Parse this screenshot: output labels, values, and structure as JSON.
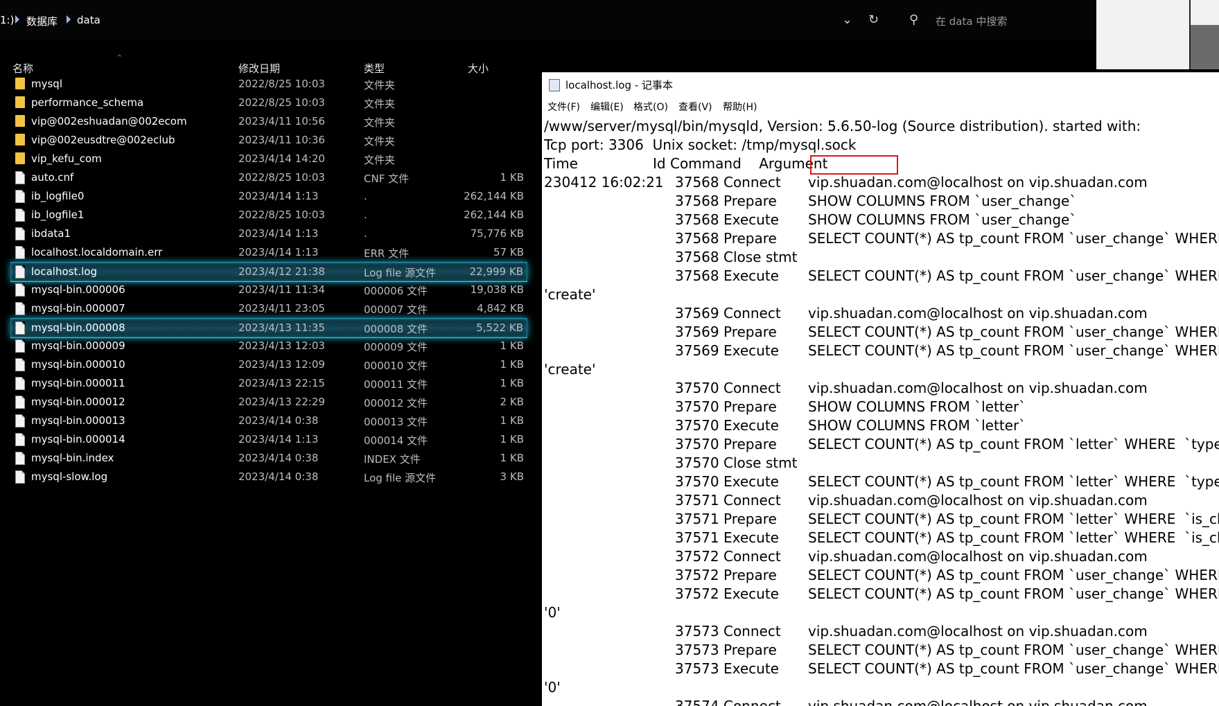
{
  "breadcrumb": {
    "drive": "1:)",
    "folder1": "数据库",
    "folder2": "data"
  },
  "toolbar": {
    "search_placeholder": "在 data 中搜索"
  },
  "columns": {
    "name": "名称",
    "date": "修改日期",
    "type": "类型",
    "size": "大小"
  },
  "files": [
    {
      "name": "mysql",
      "date": "2022/8/25 10:03",
      "type": "文件夹",
      "size": "",
      "kind": "folder"
    },
    {
      "name": "performance_schema",
      "date": "2022/8/25 10:03",
      "type": "文件夹",
      "size": "",
      "kind": "folder"
    },
    {
      "name": "vip@002eshuadan@002ecom",
      "date": "2023/4/11 10:56",
      "type": "文件夹",
      "size": "",
      "kind": "folder"
    },
    {
      "name": "vip@002eusdtre@002eclub",
      "date": "2023/4/11 10:36",
      "type": "文件夹",
      "size": "",
      "kind": "folder"
    },
    {
      "name": "vip_kefu_com",
      "date": "2023/4/14 14:20",
      "type": "文件夹",
      "size": "",
      "kind": "folder"
    },
    {
      "name": "auto.cnf",
      "date": "2022/8/25 10:03",
      "type": "CNF 文件",
      "size": "1 KB",
      "kind": "file"
    },
    {
      "name": "ib_logfile0",
      "date": "2023/4/14 1:13",
      "type": ".",
      "size": "262,144 KB",
      "kind": "file"
    },
    {
      "name": "ib_logfile1",
      "date": "2022/8/25 10:03",
      "type": ".",
      "size": "262,144 KB",
      "kind": "file"
    },
    {
      "name": "ibdata1",
      "date": "2023/4/14 1:13",
      "type": ".",
      "size": "75,776 KB",
      "kind": "file"
    },
    {
      "name": "localhost.localdomain.err",
      "date": "2023/4/14 1:13",
      "type": "ERR 文件",
      "size": "57 KB",
      "kind": "file"
    },
    {
      "name": "localhost.log",
      "date": "2023/4/12 21:38",
      "type": "Log file 源文件",
      "size": "22,999 KB",
      "kind": "file",
      "selected": true
    },
    {
      "name": "mysql-bin.000006",
      "date": "2023/4/11 11:34",
      "type": "000006 文件",
      "size": "19,038 KB",
      "kind": "file"
    },
    {
      "name": "mysql-bin.000007",
      "date": "2023/4/11 23:05",
      "type": "000007 文件",
      "size": "4,842 KB",
      "kind": "file"
    },
    {
      "name": "mysql-bin.000008",
      "date": "2023/4/13 11:35",
      "type": "000008 文件",
      "size": "5,522 KB",
      "kind": "file",
      "selected": true
    },
    {
      "name": "mysql-bin.000009",
      "date": "2023/4/13 12:03",
      "type": "000009 文件",
      "size": "1 KB",
      "kind": "file"
    },
    {
      "name": "mysql-bin.000010",
      "date": "2023/4/13 12:09",
      "type": "000010 文件",
      "size": "1 KB",
      "kind": "file"
    },
    {
      "name": "mysql-bin.000011",
      "date": "2023/4/13 22:15",
      "type": "000011 文件",
      "size": "1 KB",
      "kind": "file"
    },
    {
      "name": "mysql-bin.000012",
      "date": "2023/4/13 22:29",
      "type": "000012 文件",
      "size": "2 KB",
      "kind": "file"
    },
    {
      "name": "mysql-bin.000013",
      "date": "2023/4/14 0:38",
      "type": "000013 文件",
      "size": "1 KB",
      "kind": "file"
    },
    {
      "name": "mysql-bin.000014",
      "date": "2023/4/14 1:13",
      "type": "000014 文件",
      "size": "1 KB",
      "kind": "file"
    },
    {
      "name": "mysql-bin.index",
      "date": "2023/4/14 0:38",
      "type": "INDEX 文件",
      "size": "1 KB",
      "kind": "file"
    },
    {
      "name": "mysql-slow.log",
      "date": "2023/4/14 0:38",
      "type": "Log file 源文件",
      "size": "3 KB",
      "kind": "file"
    }
  ],
  "notepad": {
    "title": "localhost.log - 记事本",
    "menu": [
      "文件(F)",
      "编辑(E)",
      "格式(O)",
      "查看(V)",
      "帮助(H)"
    ],
    "lines": [
      {
        "full": "/www/server/mysql/bin/mysqld, Version: 5.6.50-log (Source distribution). started with:"
      },
      {
        "full": "Tcp port: 3306  Unix socket: /tmp/mysql.sock"
      },
      {
        "full": "Time                 Id Command    Argument"
      },
      {
        "time": "230412 16:02:21",
        "cmd": "37568 Connect",
        "arg": "vip.shuadan.com@localhost on vip.shuadan.com"
      },
      {
        "cmd": "37568 Prepare",
        "arg": "SHOW COLUMNS FROM `user_change`"
      },
      {
        "cmd": "37568 Execute",
        "arg": "SHOW COLUMNS FROM `user_change`"
      },
      {
        "cmd": "37568 Prepare",
        "arg": "SELECT COUNT(*) AS tp_count FROM `user_change` WHERE  `t"
      },
      {
        "cmd": "37568 Close stmt",
        "arg": ""
      },
      {
        "cmd": "37568 Execute",
        "arg": "SELECT COUNT(*) AS tp_count FROM `user_change` WHERE  `t"
      },
      {
        "full": "'create'"
      },
      {
        "cmd": "37569 Connect",
        "arg": "vip.shuadan.com@localhost on vip.shuadan.com"
      },
      {
        "cmd": "37569 Prepare",
        "arg": "SELECT COUNT(*) AS tp_count FROM `user_change` WHERE  `t"
      },
      {
        "cmd": "37569 Execute",
        "arg": "SELECT COUNT(*) AS tp_count FROM `user_change` WHERE  `t"
      },
      {
        "full": "'create'"
      },
      {
        "cmd": "37570 Connect",
        "arg": "vip.shuadan.com@localhost on vip.shuadan.com"
      },
      {
        "cmd": "37570 Prepare",
        "arg": "SHOW COLUMNS FROM `letter`"
      },
      {
        "cmd": "37570 Execute",
        "arg": "SHOW COLUMNS FROM `letter`"
      },
      {
        "cmd": "37570 Prepare",
        "arg": "SELECT COUNT(*) AS tp_count FROM `letter` WHERE  `type` ="
      },
      {
        "cmd": "37570 Close stmt",
        "arg": ""
      },
      {
        "cmd": "37570 Execute",
        "arg": "SELECT COUNT(*) AS tp_count FROM `letter` WHERE  `type` ="
      },
      {
        "cmd": "37571 Connect",
        "arg": "vip.shuadan.com@localhost on vip.shuadan.com"
      },
      {
        "cmd": "37571 Prepare",
        "arg": "SELECT COUNT(*) AS tp_count FROM `letter` WHERE  `is_check"
      },
      {
        "cmd": "37571 Execute",
        "arg": "SELECT COUNT(*) AS tp_count FROM `letter` WHERE  `is_check"
      },
      {
        "cmd": "37572 Connect",
        "arg": "vip.shuadan.com@localhost on vip.shuadan.com"
      },
      {
        "cmd": "37572 Prepare",
        "arg": "SELECT COUNT(*) AS tp_count FROM `user_change` WHERE  `t"
      },
      {
        "cmd": "37572 Execute",
        "arg": "SELECT COUNT(*) AS tp_count FROM `user_change` WHERE  `t"
      },
      {
        "full": "'0'"
      },
      {
        "cmd": "37573 Connect",
        "arg": "vip.shuadan.com@localhost on vip.shuadan.com"
      },
      {
        "cmd": "37573 Prepare",
        "arg": "SELECT COUNT(*) AS tp_count FROM `user_change` WHERE  `t"
      },
      {
        "cmd": "37573 Execute",
        "arg": "SELECT COUNT(*) AS tp_count FROM `user_change` WHERE  `t"
      },
      {
        "full": "'0'"
      },
      {
        "cmd": "37574 Connect",
        "arg": "vip.shuadan.com@localhost on vip.shuadan.com"
      }
    ]
  },
  "colors": {
    "selection_glow": "#3fc6e6",
    "highlight_box": "#e01515",
    "folder": "#f3c343"
  }
}
